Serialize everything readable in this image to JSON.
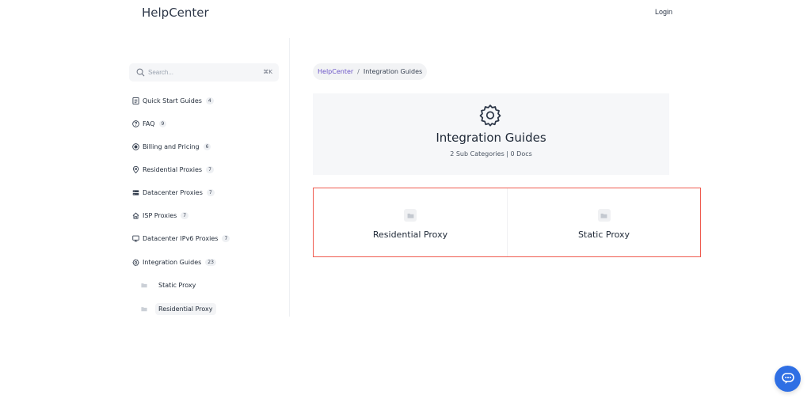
{
  "header": {
    "brand": "HelpCenter",
    "login_label": "Login"
  },
  "search": {
    "placeholder": "Search...",
    "shortcut": "⌘K"
  },
  "sidebar": {
    "items": [
      {
        "label": "Quick Start Guides",
        "count": "4",
        "icon": "document-icon"
      },
      {
        "label": "FAQ",
        "count": "9",
        "icon": "question-circle-icon"
      },
      {
        "label": "Billing and Pricing",
        "count": "6",
        "icon": "dollar-circle-icon"
      },
      {
        "label": "Residential Proxies",
        "count": "7",
        "icon": "location-pin-icon"
      },
      {
        "label": "Datacenter Proxies",
        "count": "7",
        "icon": "server-icon"
      },
      {
        "label": "ISP Proxies",
        "count": "7",
        "icon": "home-icon"
      },
      {
        "label": "Datacenter IPv6 Proxies",
        "count": "7",
        "icon": "monitor-icon"
      },
      {
        "label": "Integration Guides",
        "count": "23",
        "icon": "gear-icon"
      }
    ],
    "sub_items": [
      {
        "label": "Static Proxy",
        "icon": "folder-icon"
      },
      {
        "label": "Residential Proxy",
        "icon": "folder-icon"
      }
    ]
  },
  "breadcrumb": {
    "home": "HelpCenter",
    "separator": "/",
    "current": "Integration Guides"
  },
  "hero": {
    "icon": "gear-icon",
    "title": "Integration Guides",
    "meta": "2 Sub Categories | 0 Docs"
  },
  "cards": [
    {
      "label": "Residential Proxy",
      "icon": "folder-icon"
    },
    {
      "label": "Static Proxy",
      "icon": "folder-icon"
    }
  ],
  "colors": {
    "accent_link": "#6b54c8",
    "highlight_border": "#ef5b4f",
    "chat_button": "#2f6fe4"
  },
  "chat": {
    "icon": "chat-bubble-icon"
  }
}
